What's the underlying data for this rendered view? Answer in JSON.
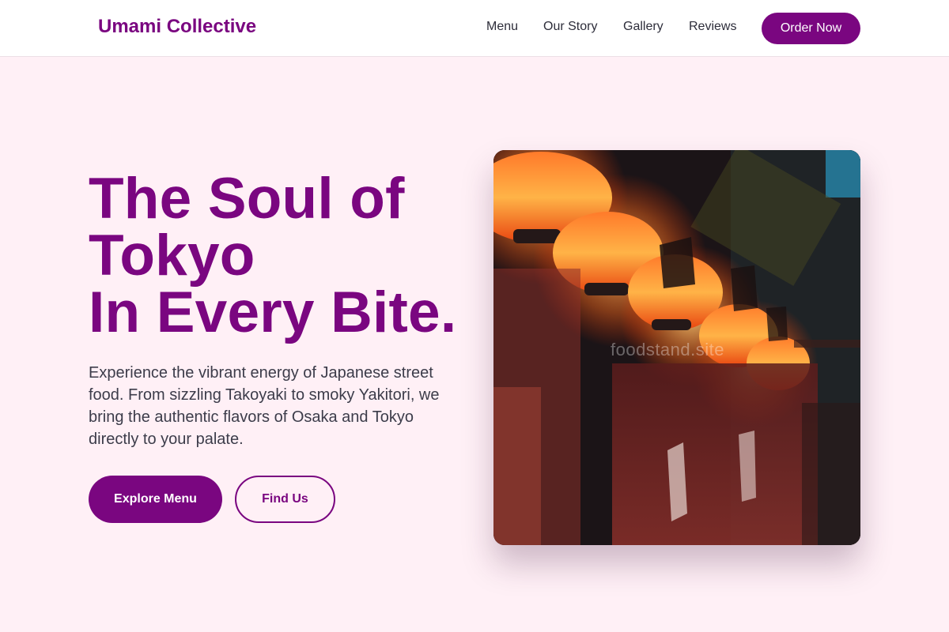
{
  "header": {
    "brand": "Umami Collective",
    "nav": [
      "Menu",
      "Our Story",
      "Gallery",
      "Reviews"
    ],
    "cta": "Order Now"
  },
  "hero": {
    "title_lines": [
      "The Soul of",
      "Tokyo",
      "In Every Bite."
    ],
    "description": "Experience the vibrant energy of Japanese street food. From sizzling Takoyaki to smoky Yakitori, we bring the authentic flavors of Osaka and Tokyo directly to your palate.",
    "primary_button": "Explore Menu",
    "secondary_button": "Find Us",
    "image_watermark": "foodstand.site"
  },
  "colors": {
    "accent": "#7a0680",
    "background": "#fff0f6",
    "text": "#3c3c4a"
  }
}
